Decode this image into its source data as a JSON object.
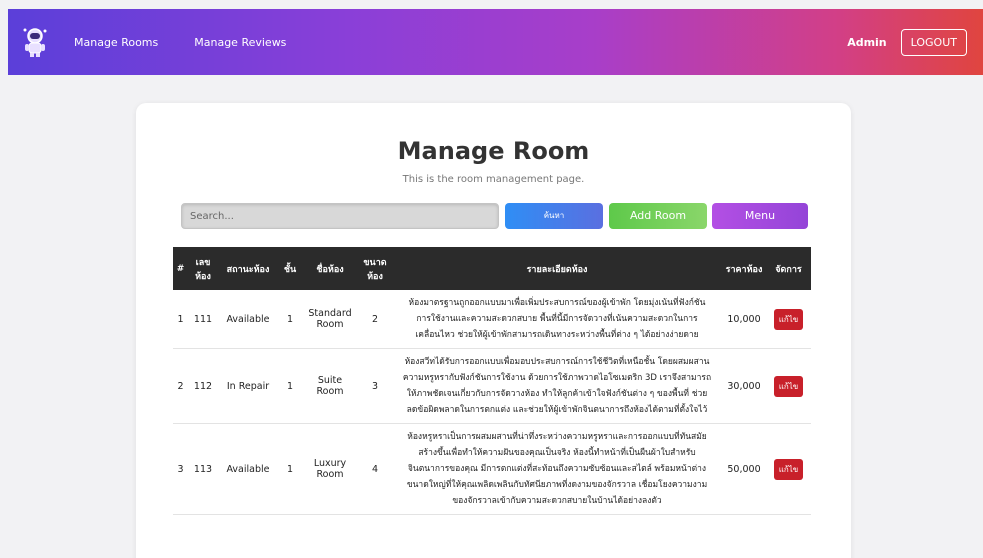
{
  "navbar": {
    "links": [
      "Manage Rooms",
      "Manage Reviews"
    ],
    "user": "Admin",
    "logout": "LOGOUT"
  },
  "page": {
    "title": "Manage Room",
    "subtitle": "This is the room management page."
  },
  "toolbar": {
    "search_placeholder": "Search...",
    "search_button": "ค้นหา",
    "add_button": "Add Room",
    "menu_button": "Menu"
  },
  "table": {
    "headers": [
      "#",
      "เลขห้อง",
      "สถานะห้อง",
      "ชั้น",
      "ชื่อห้อง",
      "ขนาดห้อง",
      "รายละเอียดห้อง",
      "ราคาห้อง",
      "จัดการ"
    ],
    "rows": [
      {
        "index": "1",
        "number": "111",
        "status": "Available",
        "floor": "1",
        "name": "Standard Room",
        "size": "2",
        "description": "ห้องมาตรฐานถูกออกแบบมาเพื่อเพิ่มประสบการณ์ของผู้เข้าพัก โดยมุ่งเน้นที่ฟังก์ชันการใช้งานและความสะดวกสบาย พื้นที่นี้มีการจัดวางที่เน้นความสะดวกในการเคลื่อนไหว ช่วยให้ผู้เข้าพักสามารถเดินทางระหว่างพื้นที่ต่าง ๆ ได้อย่างง่ายดาย",
        "price": "10,000",
        "action": "แก้ไข"
      },
      {
        "index": "2",
        "number": "112",
        "status": "In Repair",
        "floor": "1",
        "name": "Suite Room",
        "size": "3",
        "description": "ห้องสวีทได้รับการออกแบบเพื่อมอบประสบการณ์การใช้ชีวิตที่เหนือชั้น โดยผสมผสานความหรูหรากับฟังก์ชันการใช้งาน ด้วยการใช้ภาพวาดไอโซเมตริก 3D เราจึงสามารถให้ภาพชัดเจนเกี่ยวกับการจัดวางห้อง ทำให้ลูกค้าเข้าใจฟังก์ชันต่าง ๆ ของพื้นที่ ช่วยลดข้อผิดพลาดในการตกแต่ง และช่วยให้ผู้เข้าพักจินตนาการถึงห้องได้ตามที่ตั้งใจไว้",
        "price": "30,000",
        "action": "แก้ไข"
      },
      {
        "index": "3",
        "number": "113",
        "status": "Available",
        "floor": "1",
        "name": "Luxury Room",
        "size": "4",
        "description": "ห้องหรูหราเป็นการผสมผสานที่น่าทึ่งระหว่างความหรูหราและการออกแบบที่ทันสมัย สร้างขึ้นเพื่อทำให้ความฝันของคุณเป็นจริง ห้องนี้ทำหน้าที่เป็นผืนผ้าใบสำหรับจินตนาการของคุณ มีการตกแต่งที่สะท้อนถึงความซับซ้อนและสไตล์ พร้อมหน้าต่างขนาดใหญ่ที่ให้คุณเพลิดเพลินกับทัศนียภาพที่งดงามของจักรวาล เชื่อมโยงความงามของจักรวาลเข้ากับความสะดวกสบายในบ้านได้อย่างลงตัว",
        "price": "50,000",
        "action": "แก้ไข"
      }
    ]
  }
}
